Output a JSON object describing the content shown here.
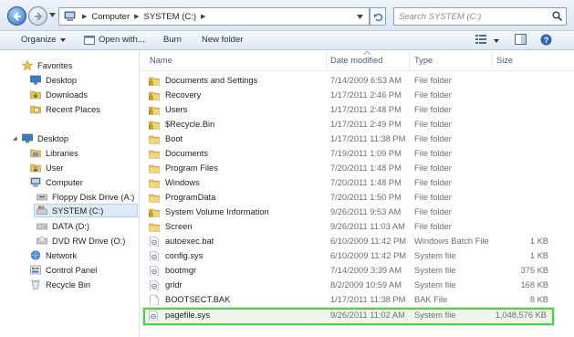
{
  "address": {
    "crumbs": [
      "Computer",
      "SYSTEM (C:)"
    ]
  },
  "search": {
    "placeholder": "Search SYSTEM (C:)"
  },
  "toolbar": {
    "organize_label": "Organize",
    "open_with_label": "Open with...",
    "burn_label": "Burn",
    "new_folder_label": "New folder"
  },
  "nav": {
    "favorites": "Favorites",
    "desktop_fav": "Desktop",
    "downloads": "Downloads",
    "recent_places": "Recent Places",
    "desktop": "Desktop",
    "libraries": "Libraries",
    "user": "User",
    "computer": "Computer",
    "floppy": "Floppy Disk Drive (A:)",
    "system_c": "SYSTEM (C:)",
    "data_d": "DATA (D:)",
    "dvd": "DVD RW Drive (O:)",
    "network": "Network",
    "control_panel": "Control Panel",
    "recycle_bin": "Recycle Bin"
  },
  "columns": {
    "name": "Name",
    "date": "Date modified",
    "type": "Type",
    "size": "Size"
  },
  "files": [
    {
      "name": "Documents and Settings",
      "date": "7/14/2009 6:53 AM",
      "type": "File folder",
      "size": "",
      "icon": "locked-folder-icon"
    },
    {
      "name": "Recovery",
      "date": "1/17/2011 2:46 PM",
      "type": "File folder",
      "size": "",
      "icon": "locked-folder-icon"
    },
    {
      "name": "Users",
      "date": "1/17/2011 2:48 PM",
      "type": "File folder",
      "size": "",
      "icon": "locked-folder-icon"
    },
    {
      "name": "$Recycle.Bin",
      "date": "1/17/2011 2:49 PM",
      "type": "File folder",
      "size": "",
      "icon": "locked-folder-icon"
    },
    {
      "name": "Boot",
      "date": "1/17/2011 11:38 PM",
      "type": "File folder",
      "size": "",
      "icon": "folder-icon"
    },
    {
      "name": "Documents",
      "date": "7/19/2011 1:09 PM",
      "type": "File folder",
      "size": "",
      "icon": "folder-icon"
    },
    {
      "name": "Program Files",
      "date": "7/20/2011 1:48 PM",
      "type": "File folder",
      "size": "",
      "icon": "folder-icon"
    },
    {
      "name": "Windows",
      "date": "7/20/2011 1:48 PM",
      "type": "File folder",
      "size": "",
      "icon": "folder-icon"
    },
    {
      "name": "ProgramData",
      "date": "7/20/2011 1:50 PM",
      "type": "File folder",
      "size": "",
      "icon": "folder-icon"
    },
    {
      "name": "System Volume Information",
      "date": "9/26/2011 9:53 AM",
      "type": "File folder",
      "size": "",
      "icon": "locked-folder-icon"
    },
    {
      "name": "Screen",
      "date": "9/26/2011 11:03 AM",
      "type": "File folder",
      "size": "",
      "icon": "folder-icon"
    },
    {
      "name": "autoexec.bat",
      "date": "6/10/2009 11:42 PM",
      "type": "Windows Batch File",
      "size": "1 KB",
      "icon": "batch-file-icon"
    },
    {
      "name": "config.sys",
      "date": "6/10/2009 11:42 PM",
      "type": "System file",
      "size": "1 KB",
      "icon": "system-file-icon"
    },
    {
      "name": "bootmgr",
      "date": "7/14/2009 3:39 AM",
      "type": "System file",
      "size": "375 KB",
      "icon": "system-file-icon"
    },
    {
      "name": "grldr",
      "date": "8/2/2009 10:59 AM",
      "type": "System file",
      "size": "168 KB",
      "icon": "system-file-icon"
    },
    {
      "name": "BOOTSECT.BAK",
      "date": "1/17/2011 11:38 PM",
      "type": "BAK File",
      "size": "8 KB",
      "icon": "blank-file-icon"
    },
    {
      "name": "pagefile.sys",
      "date": "9/26/2011 11:02 AM",
      "type": "System file",
      "size": "1,048,576 KB",
      "icon": "system-file-icon"
    }
  ],
  "selected_file_index": 16,
  "colors": {
    "folder": "#e9c25a",
    "selection_border": "#4fd14a",
    "header_text": "#4a5d7a"
  }
}
